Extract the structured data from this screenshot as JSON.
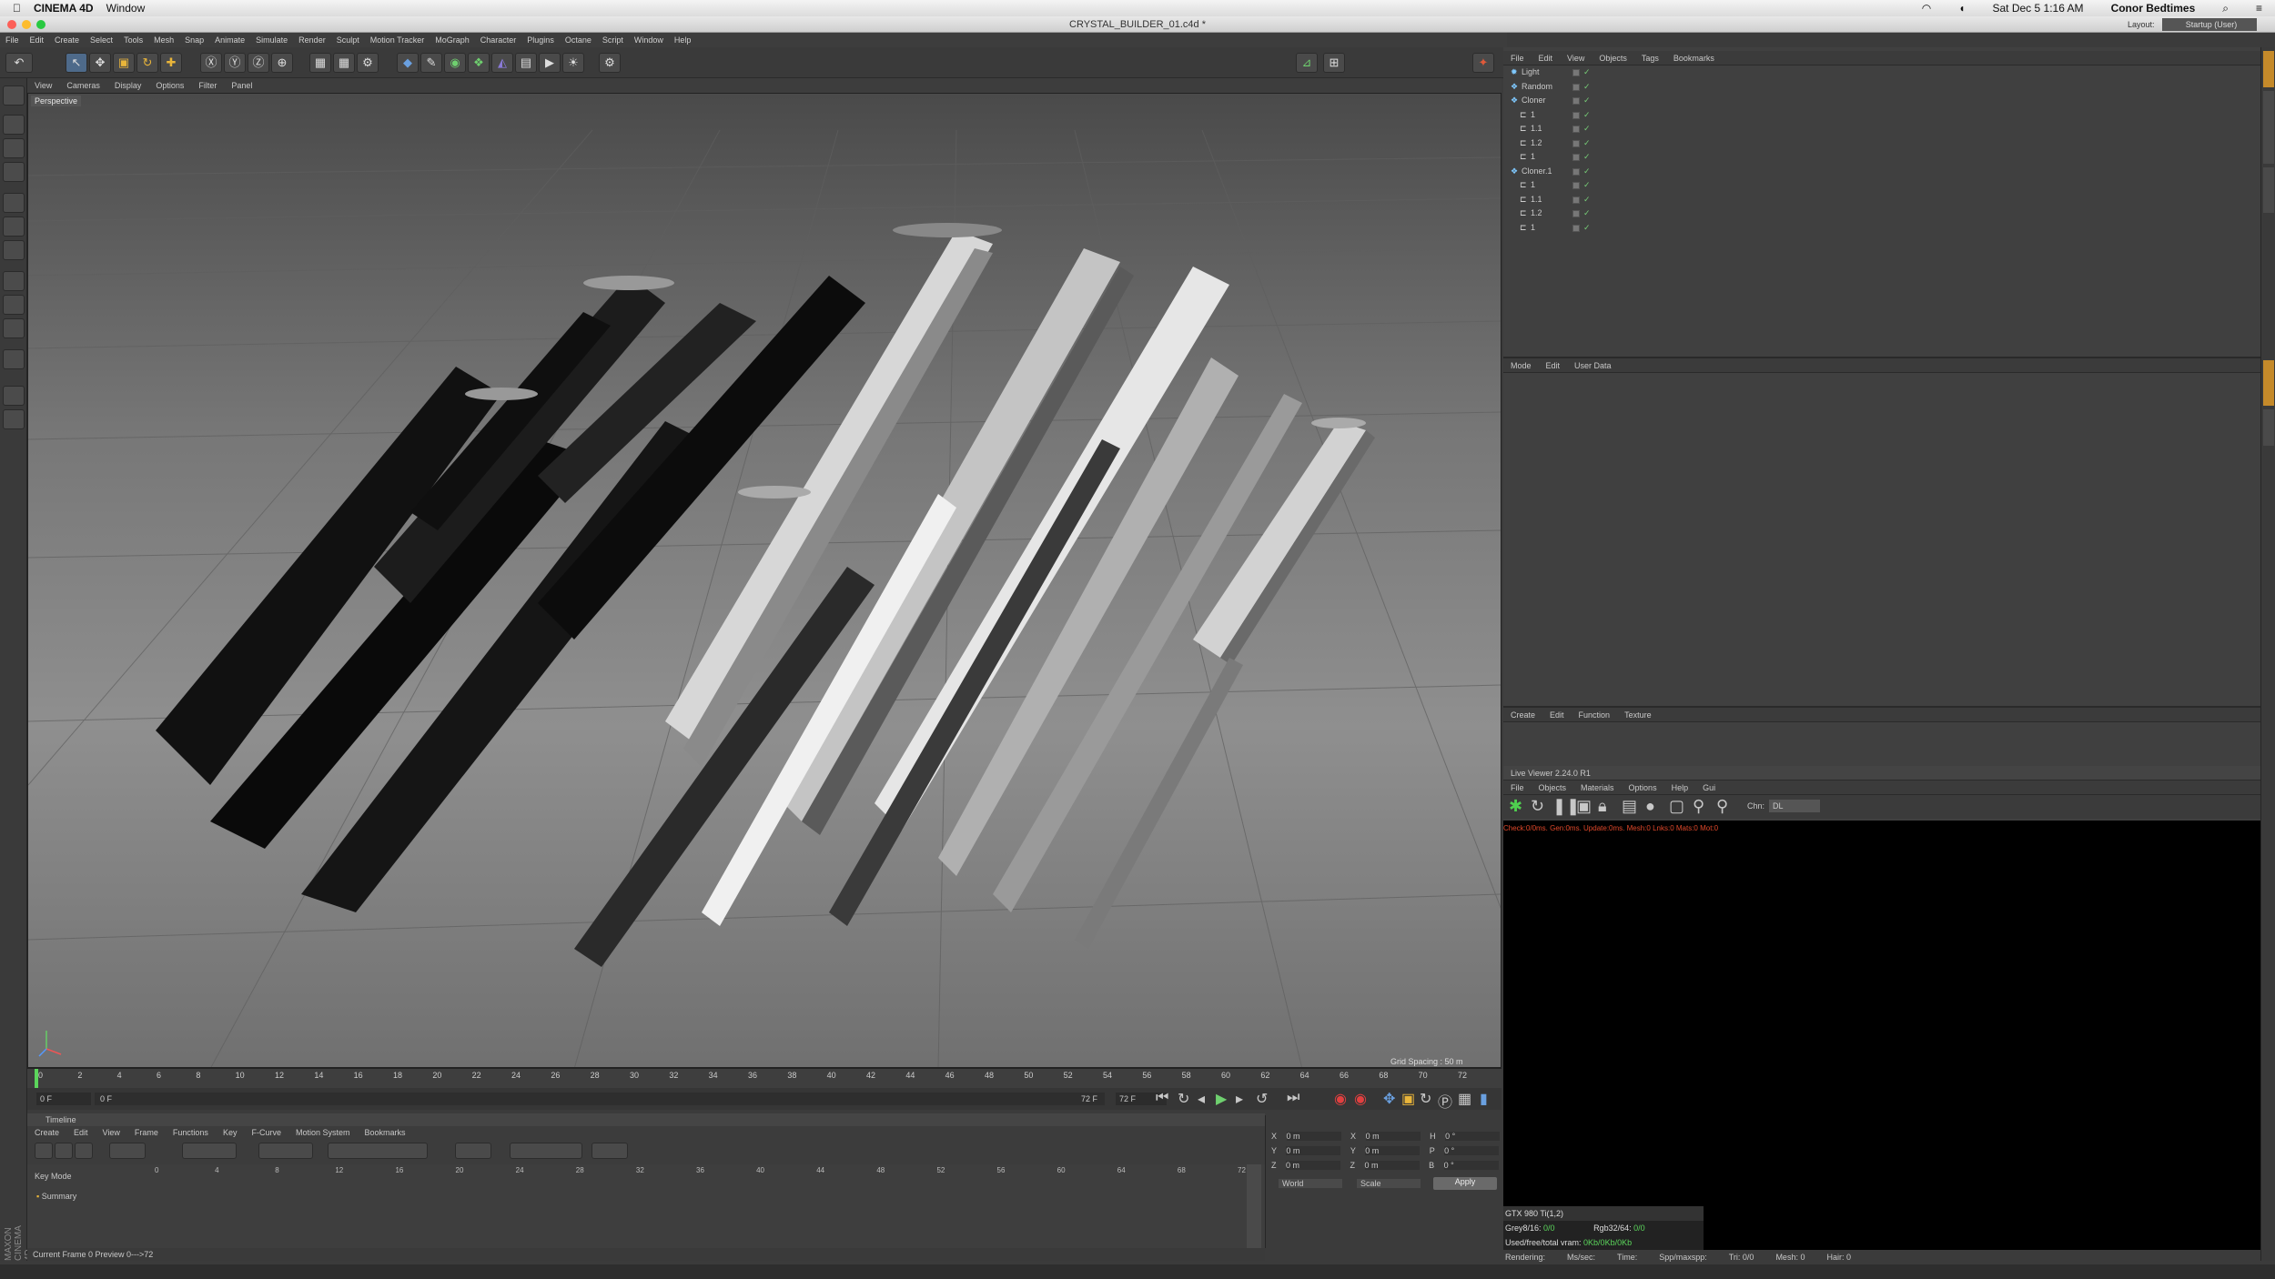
{
  "macbar": {
    "app": "CINEMA 4D",
    "menu": "Window",
    "datetime": "Sat Dec 5  1:16 AM",
    "user": "Conor Bedtimes"
  },
  "window": {
    "title": "CRYSTAL_BUILDER_01.c4d *",
    "layout_label": "Layout:",
    "layout_value": "Startup (User)"
  },
  "menu": [
    "File",
    "Edit",
    "Create",
    "Select",
    "Tools",
    "Mesh",
    "Snap",
    "Animate",
    "Simulate",
    "Render",
    "Sculpt",
    "Motion Tracker",
    "MoGraph",
    "Character",
    "Plugins",
    "Octane",
    "Script",
    "Window",
    "Help"
  ],
  "viewport": {
    "menu": [
      "View",
      "Cameras",
      "Display",
      "Options",
      "Filter",
      "Panel"
    ],
    "label": "Perspective",
    "grid_spacing": "Grid Spacing : 50 m"
  },
  "timeline_ruler": [
    "0",
    "2",
    "4",
    "6",
    "8",
    "10",
    "12",
    "14",
    "16",
    "18",
    "20",
    "22",
    "24",
    "26",
    "28",
    "30",
    "32",
    "34",
    "36",
    "38",
    "40",
    "42",
    "44",
    "46",
    "48",
    "50",
    "52",
    "54",
    "56",
    "58",
    "60",
    "62",
    "64",
    "66",
    "68",
    "70",
    "72"
  ],
  "timebar": {
    "start": "0 F",
    "cur": "0 F",
    "end_a": "72 F",
    "end_b": "72 F",
    "frame": "0 F"
  },
  "timeline": {
    "title": "Timeline",
    "menu": [
      "Create",
      "Edit",
      "View",
      "Frame",
      "Functions",
      "Key",
      "F-Curve",
      "Motion System",
      "Bookmarks"
    ],
    "key_mode": "Key Mode",
    "summary": "Summary",
    "ruler": [
      "0",
      "4",
      "8",
      "12",
      "16",
      "20",
      "24",
      "28",
      "32",
      "36",
      "40",
      "44",
      "48",
      "52",
      "56",
      "60",
      "64",
      "68",
      "72"
    ],
    "status": "Current Frame  0   Preview  0--->72"
  },
  "coords": {
    "rows": [
      {
        "a": "X",
        "av": "0 m",
        "b": "X",
        "bv": "0 m",
        "c": "H",
        "cv": "0 °"
      },
      {
        "a": "Y",
        "av": "0 m",
        "b": "Y",
        "bv": "0 m",
        "c": "P",
        "cv": "0 °"
      },
      {
        "a": "Z",
        "av": "0 m",
        "b": "Z",
        "bv": "0 m",
        "c": "B",
        "cv": "0 °"
      }
    ],
    "world": "World",
    "scale": "Scale",
    "apply": "Apply"
  },
  "objects": {
    "menu": [
      "File",
      "Edit",
      "View",
      "Objects",
      "Tags",
      "Bookmarks"
    ],
    "items": [
      {
        "name": "Light",
        "indent": 0
      },
      {
        "name": "Random",
        "indent": 0
      },
      {
        "name": "Cloner",
        "indent": 0
      },
      {
        "name": "1",
        "indent": 1
      },
      {
        "name": "1.1",
        "indent": 1
      },
      {
        "name": "1.2",
        "indent": 1
      },
      {
        "name": "1",
        "indent": 1
      },
      {
        "name": "Cloner.1",
        "indent": 0
      },
      {
        "name": "1",
        "indent": 1
      },
      {
        "name": "1.1",
        "indent": 1
      },
      {
        "name": "1.2",
        "indent": 1
      },
      {
        "name": "1",
        "indent": 1
      }
    ]
  },
  "attributes": {
    "menu": [
      "Mode",
      "Edit",
      "User Data"
    ]
  },
  "materials": {
    "menu": [
      "Create",
      "Edit",
      "Function",
      "Texture"
    ]
  },
  "live_viewer": {
    "title": "Live Viewer 2.24.0 R1",
    "menu": [
      "File",
      "Objects",
      "Materials",
      "Options",
      "Help",
      "Gui"
    ],
    "chn_label": "Chn:",
    "chn_value": "DL",
    "status": "Check:0/0ms. Gen:0ms. Update:0ms. Mesh:0 Lnks:0 Mats:0 Mot:0",
    "gpu": "GTX 980 Ti(1,2)",
    "grey": "Grey8/16: ",
    "grey_v": "0/0",
    "rgb": "Rgb32/64: ",
    "rgb_v": "0/0",
    "vram": "Used/free/total vram: ",
    "vram_v": "0Kb/0Kb/0Kb",
    "render": [
      "Rendering:",
      "Ms/sec:",
      "Time:",
      "Spp/maxspp:",
      "Tri: 0/0",
      "Mesh: 0",
      "Hair: 0"
    ]
  },
  "maxon": "MAXON CINEMA 4D"
}
